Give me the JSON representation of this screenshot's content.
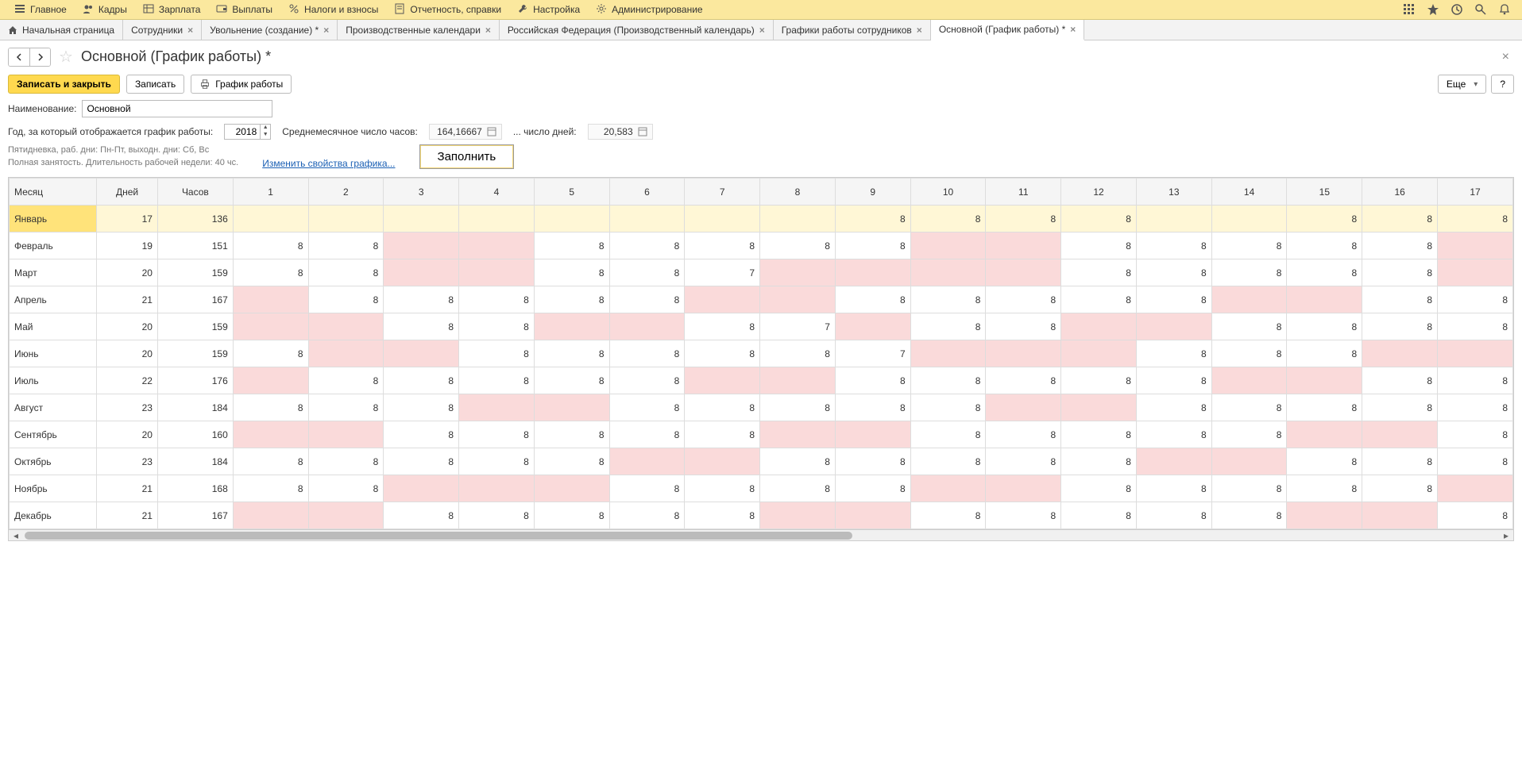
{
  "menu": {
    "items": [
      {
        "label": "Главное",
        "icon": "menu"
      },
      {
        "label": "Кадры",
        "icon": "people"
      },
      {
        "label": "Зарплата",
        "icon": "table"
      },
      {
        "label": "Выплаты",
        "icon": "wallet"
      },
      {
        "label": "Налоги и взносы",
        "icon": "percent"
      },
      {
        "label": "Отчетность, справки",
        "icon": "report"
      },
      {
        "label": "Настройка",
        "icon": "wrench"
      },
      {
        "label": "Администрирование",
        "icon": "gear"
      }
    ]
  },
  "tabs": [
    {
      "label": "Начальная страница",
      "home": true,
      "closable": false
    },
    {
      "label": "Сотрудники",
      "closable": true
    },
    {
      "label": "Увольнение (создание) *",
      "closable": true
    },
    {
      "label": "Производственные календари",
      "closable": true
    },
    {
      "label": "Российская Федерация (Производственный календарь)",
      "closable": true
    },
    {
      "label": "Графики работы сотрудников",
      "closable": true
    },
    {
      "label": "Основной (График работы) *",
      "closable": true,
      "active": true
    }
  ],
  "page": {
    "title": "Основной (График работы) *",
    "buttons": {
      "save_close": "Записать и закрыть",
      "save": "Записать",
      "print": "График работы",
      "more": "Еще",
      "help": "?"
    },
    "name_label": "Наименование:",
    "name_value": "Основной",
    "year_label": "Год, за который отображается график работы:",
    "year_value": "2018",
    "avg_hours_label": "Среднемесячное число часов:",
    "avg_hours_value": "164,16667",
    "avg_days_label": "... число дней:",
    "avg_days_value": "20,583",
    "desc_line1": "Пятидневка, раб. дни: Пн-Пт, выходн. дни: Сб, Вс",
    "desc_line2": "Полная занятость. Длительность рабочей недели: 40 чс.",
    "change_link": "Изменить свойства графика...",
    "fill_btn": "Заполнить"
  },
  "table": {
    "headers": {
      "month": "Месяц",
      "days": "Дней",
      "hours": "Часов"
    },
    "day_cols": [
      1,
      2,
      3,
      4,
      5,
      6,
      7,
      8,
      9,
      10,
      11,
      12,
      13,
      14,
      15,
      16,
      17
    ],
    "rows": [
      {
        "month": "Январь",
        "days": 17,
        "hours": 136,
        "selected": true,
        "cells": [
          {
            "v": "",
            "w": false
          },
          {
            "v": "",
            "w": false
          },
          {
            "v": "",
            "w": false
          },
          {
            "v": "",
            "w": false
          },
          {
            "v": "",
            "w": false
          },
          {
            "v": "",
            "w": false
          },
          {
            "v": "",
            "w": false
          },
          {
            "v": "",
            "w": false
          },
          {
            "v": "8",
            "w": false
          },
          {
            "v": "8",
            "w": false
          },
          {
            "v": "8",
            "w": false
          },
          {
            "v": "8",
            "w": false
          },
          {
            "v": "",
            "w": false
          },
          {
            "v": "",
            "w": false
          },
          {
            "v": "8",
            "w": false
          },
          {
            "v": "8",
            "w": false
          },
          {
            "v": "8",
            "w": false
          }
        ]
      },
      {
        "month": "Февраль",
        "days": 19,
        "hours": 151,
        "cells": [
          {
            "v": "8",
            "w": false
          },
          {
            "v": "8",
            "w": false
          },
          {
            "v": "",
            "w": true
          },
          {
            "v": "",
            "w": true
          },
          {
            "v": "8",
            "w": false
          },
          {
            "v": "8",
            "w": false
          },
          {
            "v": "8",
            "w": false
          },
          {
            "v": "8",
            "w": false
          },
          {
            "v": "8",
            "w": false
          },
          {
            "v": "",
            "w": true
          },
          {
            "v": "",
            "w": true
          },
          {
            "v": "8",
            "w": false
          },
          {
            "v": "8",
            "w": false
          },
          {
            "v": "8",
            "w": false
          },
          {
            "v": "8",
            "w": false
          },
          {
            "v": "8",
            "w": false
          },
          {
            "v": "",
            "w": true
          }
        ]
      },
      {
        "month": "Март",
        "days": 20,
        "hours": 159,
        "cells": [
          {
            "v": "8",
            "w": false
          },
          {
            "v": "8",
            "w": false
          },
          {
            "v": "",
            "w": true
          },
          {
            "v": "",
            "w": true
          },
          {
            "v": "8",
            "w": false
          },
          {
            "v": "8",
            "w": false
          },
          {
            "v": "7",
            "w": false
          },
          {
            "v": "",
            "w": true
          },
          {
            "v": "",
            "w": true
          },
          {
            "v": "",
            "w": true
          },
          {
            "v": "",
            "w": true
          },
          {
            "v": "8",
            "w": false
          },
          {
            "v": "8",
            "w": false
          },
          {
            "v": "8",
            "w": false
          },
          {
            "v": "8",
            "w": false
          },
          {
            "v": "8",
            "w": false
          },
          {
            "v": "",
            "w": true
          }
        ]
      },
      {
        "month": "Апрель",
        "days": 21,
        "hours": 167,
        "cells": [
          {
            "v": "",
            "w": true
          },
          {
            "v": "8",
            "w": false
          },
          {
            "v": "8",
            "w": false
          },
          {
            "v": "8",
            "w": false
          },
          {
            "v": "8",
            "w": false
          },
          {
            "v": "8",
            "w": false
          },
          {
            "v": "",
            "w": true
          },
          {
            "v": "",
            "w": true
          },
          {
            "v": "8",
            "w": false
          },
          {
            "v": "8",
            "w": false
          },
          {
            "v": "8",
            "w": false
          },
          {
            "v": "8",
            "w": false
          },
          {
            "v": "8",
            "w": false
          },
          {
            "v": "",
            "w": true
          },
          {
            "v": "",
            "w": true
          },
          {
            "v": "8",
            "w": false
          },
          {
            "v": "8",
            "w": false
          }
        ]
      },
      {
        "month": "Май",
        "days": 20,
        "hours": 159,
        "cells": [
          {
            "v": "",
            "w": true
          },
          {
            "v": "",
            "w": true
          },
          {
            "v": "8",
            "w": false
          },
          {
            "v": "8",
            "w": false
          },
          {
            "v": "",
            "w": true
          },
          {
            "v": "",
            "w": true
          },
          {
            "v": "8",
            "w": false
          },
          {
            "v": "7",
            "w": false
          },
          {
            "v": "",
            "w": true
          },
          {
            "v": "8",
            "w": false
          },
          {
            "v": "8",
            "w": false
          },
          {
            "v": "",
            "w": true
          },
          {
            "v": "",
            "w": true
          },
          {
            "v": "8",
            "w": false
          },
          {
            "v": "8",
            "w": false
          },
          {
            "v": "8",
            "w": false
          },
          {
            "v": "8",
            "w": false
          }
        ]
      },
      {
        "month": "Июнь",
        "days": 20,
        "hours": 159,
        "cells": [
          {
            "v": "8",
            "w": false
          },
          {
            "v": "",
            "w": true
          },
          {
            "v": "",
            "w": true
          },
          {
            "v": "8",
            "w": false
          },
          {
            "v": "8",
            "w": false
          },
          {
            "v": "8",
            "w": false
          },
          {
            "v": "8",
            "w": false
          },
          {
            "v": "8",
            "w": false
          },
          {
            "v": "7",
            "w": false
          },
          {
            "v": "",
            "w": true
          },
          {
            "v": "",
            "w": true
          },
          {
            "v": "",
            "w": true
          },
          {
            "v": "8",
            "w": false
          },
          {
            "v": "8",
            "w": false
          },
          {
            "v": "8",
            "w": false
          },
          {
            "v": "",
            "w": true
          },
          {
            "v": "",
            "w": true
          }
        ]
      },
      {
        "month": "Июль",
        "days": 22,
        "hours": 176,
        "cells": [
          {
            "v": "",
            "w": true
          },
          {
            "v": "8",
            "w": false
          },
          {
            "v": "8",
            "w": false
          },
          {
            "v": "8",
            "w": false
          },
          {
            "v": "8",
            "w": false
          },
          {
            "v": "8",
            "w": false
          },
          {
            "v": "",
            "w": true
          },
          {
            "v": "",
            "w": true
          },
          {
            "v": "8",
            "w": false
          },
          {
            "v": "8",
            "w": false
          },
          {
            "v": "8",
            "w": false
          },
          {
            "v": "8",
            "w": false
          },
          {
            "v": "8",
            "w": false
          },
          {
            "v": "",
            "w": true
          },
          {
            "v": "",
            "w": true
          },
          {
            "v": "8",
            "w": false
          },
          {
            "v": "8",
            "w": false
          }
        ]
      },
      {
        "month": "Август",
        "days": 23,
        "hours": 184,
        "cells": [
          {
            "v": "8",
            "w": false
          },
          {
            "v": "8",
            "w": false
          },
          {
            "v": "8",
            "w": false
          },
          {
            "v": "",
            "w": true
          },
          {
            "v": "",
            "w": true
          },
          {
            "v": "8",
            "w": false
          },
          {
            "v": "8",
            "w": false
          },
          {
            "v": "8",
            "w": false
          },
          {
            "v": "8",
            "w": false
          },
          {
            "v": "8",
            "w": false
          },
          {
            "v": "",
            "w": true
          },
          {
            "v": "",
            "w": true
          },
          {
            "v": "8",
            "w": false
          },
          {
            "v": "8",
            "w": false
          },
          {
            "v": "8",
            "w": false
          },
          {
            "v": "8",
            "w": false
          },
          {
            "v": "8",
            "w": false
          }
        ]
      },
      {
        "month": "Сентябрь",
        "days": 20,
        "hours": 160,
        "cells": [
          {
            "v": "",
            "w": true
          },
          {
            "v": "",
            "w": true
          },
          {
            "v": "8",
            "w": false
          },
          {
            "v": "8",
            "w": false
          },
          {
            "v": "8",
            "w": false
          },
          {
            "v": "8",
            "w": false
          },
          {
            "v": "8",
            "w": false
          },
          {
            "v": "",
            "w": true
          },
          {
            "v": "",
            "w": true
          },
          {
            "v": "8",
            "w": false
          },
          {
            "v": "8",
            "w": false
          },
          {
            "v": "8",
            "w": false
          },
          {
            "v": "8",
            "w": false
          },
          {
            "v": "8",
            "w": false
          },
          {
            "v": "",
            "w": true
          },
          {
            "v": "",
            "w": true
          },
          {
            "v": "8",
            "w": false
          }
        ]
      },
      {
        "month": "Октябрь",
        "days": 23,
        "hours": 184,
        "cells": [
          {
            "v": "8",
            "w": false
          },
          {
            "v": "8",
            "w": false
          },
          {
            "v": "8",
            "w": false
          },
          {
            "v": "8",
            "w": false
          },
          {
            "v": "8",
            "w": false
          },
          {
            "v": "",
            "w": true
          },
          {
            "v": "",
            "w": true
          },
          {
            "v": "8",
            "w": false
          },
          {
            "v": "8",
            "w": false
          },
          {
            "v": "8",
            "w": false
          },
          {
            "v": "8",
            "w": false
          },
          {
            "v": "8",
            "w": false
          },
          {
            "v": "",
            "w": true
          },
          {
            "v": "",
            "w": true
          },
          {
            "v": "8",
            "w": false
          },
          {
            "v": "8",
            "w": false
          },
          {
            "v": "8",
            "w": false
          }
        ]
      },
      {
        "month": "Ноябрь",
        "days": 21,
        "hours": 168,
        "cells": [
          {
            "v": "8",
            "w": false
          },
          {
            "v": "8",
            "w": false
          },
          {
            "v": "",
            "w": true
          },
          {
            "v": "",
            "w": true
          },
          {
            "v": "",
            "w": true
          },
          {
            "v": "8",
            "w": false
          },
          {
            "v": "8",
            "w": false
          },
          {
            "v": "8",
            "w": false
          },
          {
            "v": "8",
            "w": false
          },
          {
            "v": "",
            "w": true
          },
          {
            "v": "",
            "w": true
          },
          {
            "v": "8",
            "w": false
          },
          {
            "v": "8",
            "w": false
          },
          {
            "v": "8",
            "w": false
          },
          {
            "v": "8",
            "w": false
          },
          {
            "v": "8",
            "w": false
          },
          {
            "v": "",
            "w": true
          }
        ]
      },
      {
        "month": "Декабрь",
        "days": 21,
        "hours": 167,
        "cells": [
          {
            "v": "",
            "w": true
          },
          {
            "v": "",
            "w": true
          },
          {
            "v": "8",
            "w": false
          },
          {
            "v": "8",
            "w": false
          },
          {
            "v": "8",
            "w": false
          },
          {
            "v": "8",
            "w": false
          },
          {
            "v": "8",
            "w": false
          },
          {
            "v": "",
            "w": true
          },
          {
            "v": "",
            "w": true
          },
          {
            "v": "8",
            "w": false
          },
          {
            "v": "8",
            "w": false
          },
          {
            "v": "8",
            "w": false
          },
          {
            "v": "8",
            "w": false
          },
          {
            "v": "8",
            "w": false
          },
          {
            "v": "",
            "w": true
          },
          {
            "v": "",
            "w": true
          },
          {
            "v": "8",
            "w": false
          }
        ]
      }
    ]
  }
}
